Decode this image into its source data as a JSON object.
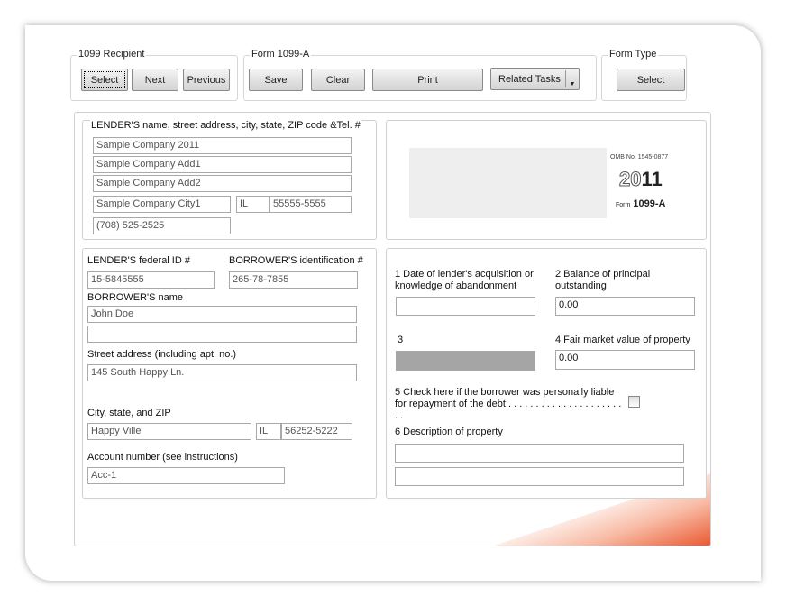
{
  "toolbar": {
    "recipient": {
      "legend": "1099 Recipient",
      "select": "Select",
      "next": "Next",
      "previous": "Previous"
    },
    "form": {
      "legend": "Form 1099-A",
      "save": "Save",
      "clear": "Clear",
      "print": "Print",
      "related": "Related Tasks"
    },
    "form_type": {
      "legend": "Form Type",
      "select": "Select"
    }
  },
  "lender": {
    "label": "LENDER'S name, street address, city, state, ZIP code &Tel. #",
    "name": "Sample Company 2011",
    "add1": "Sample Company  Add1",
    "add2": "Sample Company  Add2",
    "city": "Sample Company City1",
    "state": "IL",
    "zip": "55555-5555",
    "phone": "(708) 525-2525"
  },
  "header": {
    "omb": "OMB No. 1545-0877",
    "year_outline": "20",
    "year_bold": "11",
    "form_prefix": "Form",
    "form_name": "1099-A"
  },
  "borrower": {
    "lender_id_label": "LENDER'S federal ID #",
    "lender_id": "15-5845555",
    "borrower_id_label": "BORROWER'S identification #",
    "borrower_id": "265-78-7855",
    "name_label": "BORROWER'S name",
    "name": "John Doe",
    "name2": "",
    "street_label": "Street address (including apt. no.)",
    "street": "145 South Happy Ln.",
    "city_label": "City, state, and ZIP",
    "city": "Happy Ville",
    "state": "IL",
    "zip": "56252-5222",
    "account_label": "Account number (see instructions)",
    "account": "Acc-1"
  },
  "boxes": {
    "b1": "1 Date of lender's acquisition or knowledge of abandonment",
    "b1_value": "",
    "b2": "2 Balance of principal outstanding",
    "b2_value": "0.00",
    "b3": "3",
    "b4": "4 Fair market value of property",
    "b4_value": "0.00",
    "b5": "5 Check here if the borrower was personally liable for repayment of the debt . . . . . . . . . . . . . . . . . . . . . . .",
    "b6": "6 Description of property",
    "b6_value1": "",
    "b6_value2": ""
  }
}
